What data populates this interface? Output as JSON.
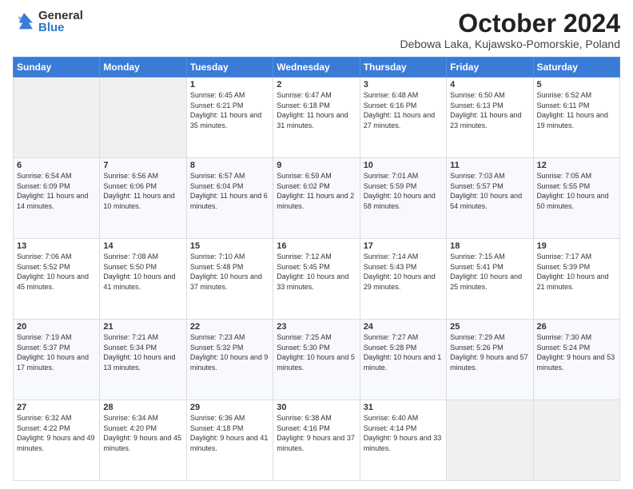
{
  "logo": {
    "general": "General",
    "blue": "Blue"
  },
  "header": {
    "month": "October 2024",
    "location": "Debowa Laka, Kujawsko-Pomorskie, Poland"
  },
  "days": [
    "Sunday",
    "Monday",
    "Tuesday",
    "Wednesday",
    "Thursday",
    "Friday",
    "Saturday"
  ],
  "weeks": [
    [
      {
        "day": "",
        "sunrise": "",
        "sunset": "",
        "daylight": ""
      },
      {
        "day": "",
        "sunrise": "",
        "sunset": "",
        "daylight": ""
      },
      {
        "day": "1",
        "sunrise": "Sunrise: 6:45 AM",
        "sunset": "Sunset: 6:21 PM",
        "daylight": "Daylight: 11 hours and 35 minutes."
      },
      {
        "day": "2",
        "sunrise": "Sunrise: 6:47 AM",
        "sunset": "Sunset: 6:18 PM",
        "daylight": "Daylight: 11 hours and 31 minutes."
      },
      {
        "day": "3",
        "sunrise": "Sunrise: 6:48 AM",
        "sunset": "Sunset: 6:16 PM",
        "daylight": "Daylight: 11 hours and 27 minutes."
      },
      {
        "day": "4",
        "sunrise": "Sunrise: 6:50 AM",
        "sunset": "Sunset: 6:13 PM",
        "daylight": "Daylight: 11 hours and 23 minutes."
      },
      {
        "day": "5",
        "sunrise": "Sunrise: 6:52 AM",
        "sunset": "Sunset: 6:11 PM",
        "daylight": "Daylight: 11 hours and 19 minutes."
      }
    ],
    [
      {
        "day": "6",
        "sunrise": "Sunrise: 6:54 AM",
        "sunset": "Sunset: 6:09 PM",
        "daylight": "Daylight: 11 hours and 14 minutes."
      },
      {
        "day": "7",
        "sunrise": "Sunrise: 6:56 AM",
        "sunset": "Sunset: 6:06 PM",
        "daylight": "Daylight: 11 hours and 10 minutes."
      },
      {
        "day": "8",
        "sunrise": "Sunrise: 6:57 AM",
        "sunset": "Sunset: 6:04 PM",
        "daylight": "Daylight: 11 hours and 6 minutes."
      },
      {
        "day": "9",
        "sunrise": "Sunrise: 6:59 AM",
        "sunset": "Sunset: 6:02 PM",
        "daylight": "Daylight: 11 hours and 2 minutes."
      },
      {
        "day": "10",
        "sunrise": "Sunrise: 7:01 AM",
        "sunset": "Sunset: 5:59 PM",
        "daylight": "Daylight: 10 hours and 58 minutes."
      },
      {
        "day": "11",
        "sunrise": "Sunrise: 7:03 AM",
        "sunset": "Sunset: 5:57 PM",
        "daylight": "Daylight: 10 hours and 54 minutes."
      },
      {
        "day": "12",
        "sunrise": "Sunrise: 7:05 AM",
        "sunset": "Sunset: 5:55 PM",
        "daylight": "Daylight: 10 hours and 50 minutes."
      }
    ],
    [
      {
        "day": "13",
        "sunrise": "Sunrise: 7:06 AM",
        "sunset": "Sunset: 5:52 PM",
        "daylight": "Daylight: 10 hours and 45 minutes."
      },
      {
        "day": "14",
        "sunrise": "Sunrise: 7:08 AM",
        "sunset": "Sunset: 5:50 PM",
        "daylight": "Daylight: 10 hours and 41 minutes."
      },
      {
        "day": "15",
        "sunrise": "Sunrise: 7:10 AM",
        "sunset": "Sunset: 5:48 PM",
        "daylight": "Daylight: 10 hours and 37 minutes."
      },
      {
        "day": "16",
        "sunrise": "Sunrise: 7:12 AM",
        "sunset": "Sunset: 5:45 PM",
        "daylight": "Daylight: 10 hours and 33 minutes."
      },
      {
        "day": "17",
        "sunrise": "Sunrise: 7:14 AM",
        "sunset": "Sunset: 5:43 PM",
        "daylight": "Daylight: 10 hours and 29 minutes."
      },
      {
        "day": "18",
        "sunrise": "Sunrise: 7:15 AM",
        "sunset": "Sunset: 5:41 PM",
        "daylight": "Daylight: 10 hours and 25 minutes."
      },
      {
        "day": "19",
        "sunrise": "Sunrise: 7:17 AM",
        "sunset": "Sunset: 5:39 PM",
        "daylight": "Daylight: 10 hours and 21 minutes."
      }
    ],
    [
      {
        "day": "20",
        "sunrise": "Sunrise: 7:19 AM",
        "sunset": "Sunset: 5:37 PM",
        "daylight": "Daylight: 10 hours and 17 minutes."
      },
      {
        "day": "21",
        "sunrise": "Sunrise: 7:21 AM",
        "sunset": "Sunset: 5:34 PM",
        "daylight": "Daylight: 10 hours and 13 minutes."
      },
      {
        "day": "22",
        "sunrise": "Sunrise: 7:23 AM",
        "sunset": "Sunset: 5:32 PM",
        "daylight": "Daylight: 10 hours and 9 minutes."
      },
      {
        "day": "23",
        "sunrise": "Sunrise: 7:25 AM",
        "sunset": "Sunset: 5:30 PM",
        "daylight": "Daylight: 10 hours and 5 minutes."
      },
      {
        "day": "24",
        "sunrise": "Sunrise: 7:27 AM",
        "sunset": "Sunset: 5:28 PM",
        "daylight": "Daylight: 10 hours and 1 minute."
      },
      {
        "day": "25",
        "sunrise": "Sunrise: 7:29 AM",
        "sunset": "Sunset: 5:26 PM",
        "daylight": "Daylight: 9 hours and 57 minutes."
      },
      {
        "day": "26",
        "sunrise": "Sunrise: 7:30 AM",
        "sunset": "Sunset: 5:24 PM",
        "daylight": "Daylight: 9 hours and 53 minutes."
      }
    ],
    [
      {
        "day": "27",
        "sunrise": "Sunrise: 6:32 AM",
        "sunset": "Sunset: 4:22 PM",
        "daylight": "Daylight: 9 hours and 49 minutes."
      },
      {
        "day": "28",
        "sunrise": "Sunrise: 6:34 AM",
        "sunset": "Sunset: 4:20 PM",
        "daylight": "Daylight: 9 hours and 45 minutes."
      },
      {
        "day": "29",
        "sunrise": "Sunrise: 6:36 AM",
        "sunset": "Sunset: 4:18 PM",
        "daylight": "Daylight: 9 hours and 41 minutes."
      },
      {
        "day": "30",
        "sunrise": "Sunrise: 6:38 AM",
        "sunset": "Sunset: 4:16 PM",
        "daylight": "Daylight: 9 hours and 37 minutes."
      },
      {
        "day": "31",
        "sunrise": "Sunrise: 6:40 AM",
        "sunset": "Sunset: 4:14 PM",
        "daylight": "Daylight: 9 hours and 33 minutes."
      },
      {
        "day": "",
        "sunrise": "",
        "sunset": "",
        "daylight": ""
      },
      {
        "day": "",
        "sunrise": "",
        "sunset": "",
        "daylight": ""
      }
    ]
  ]
}
